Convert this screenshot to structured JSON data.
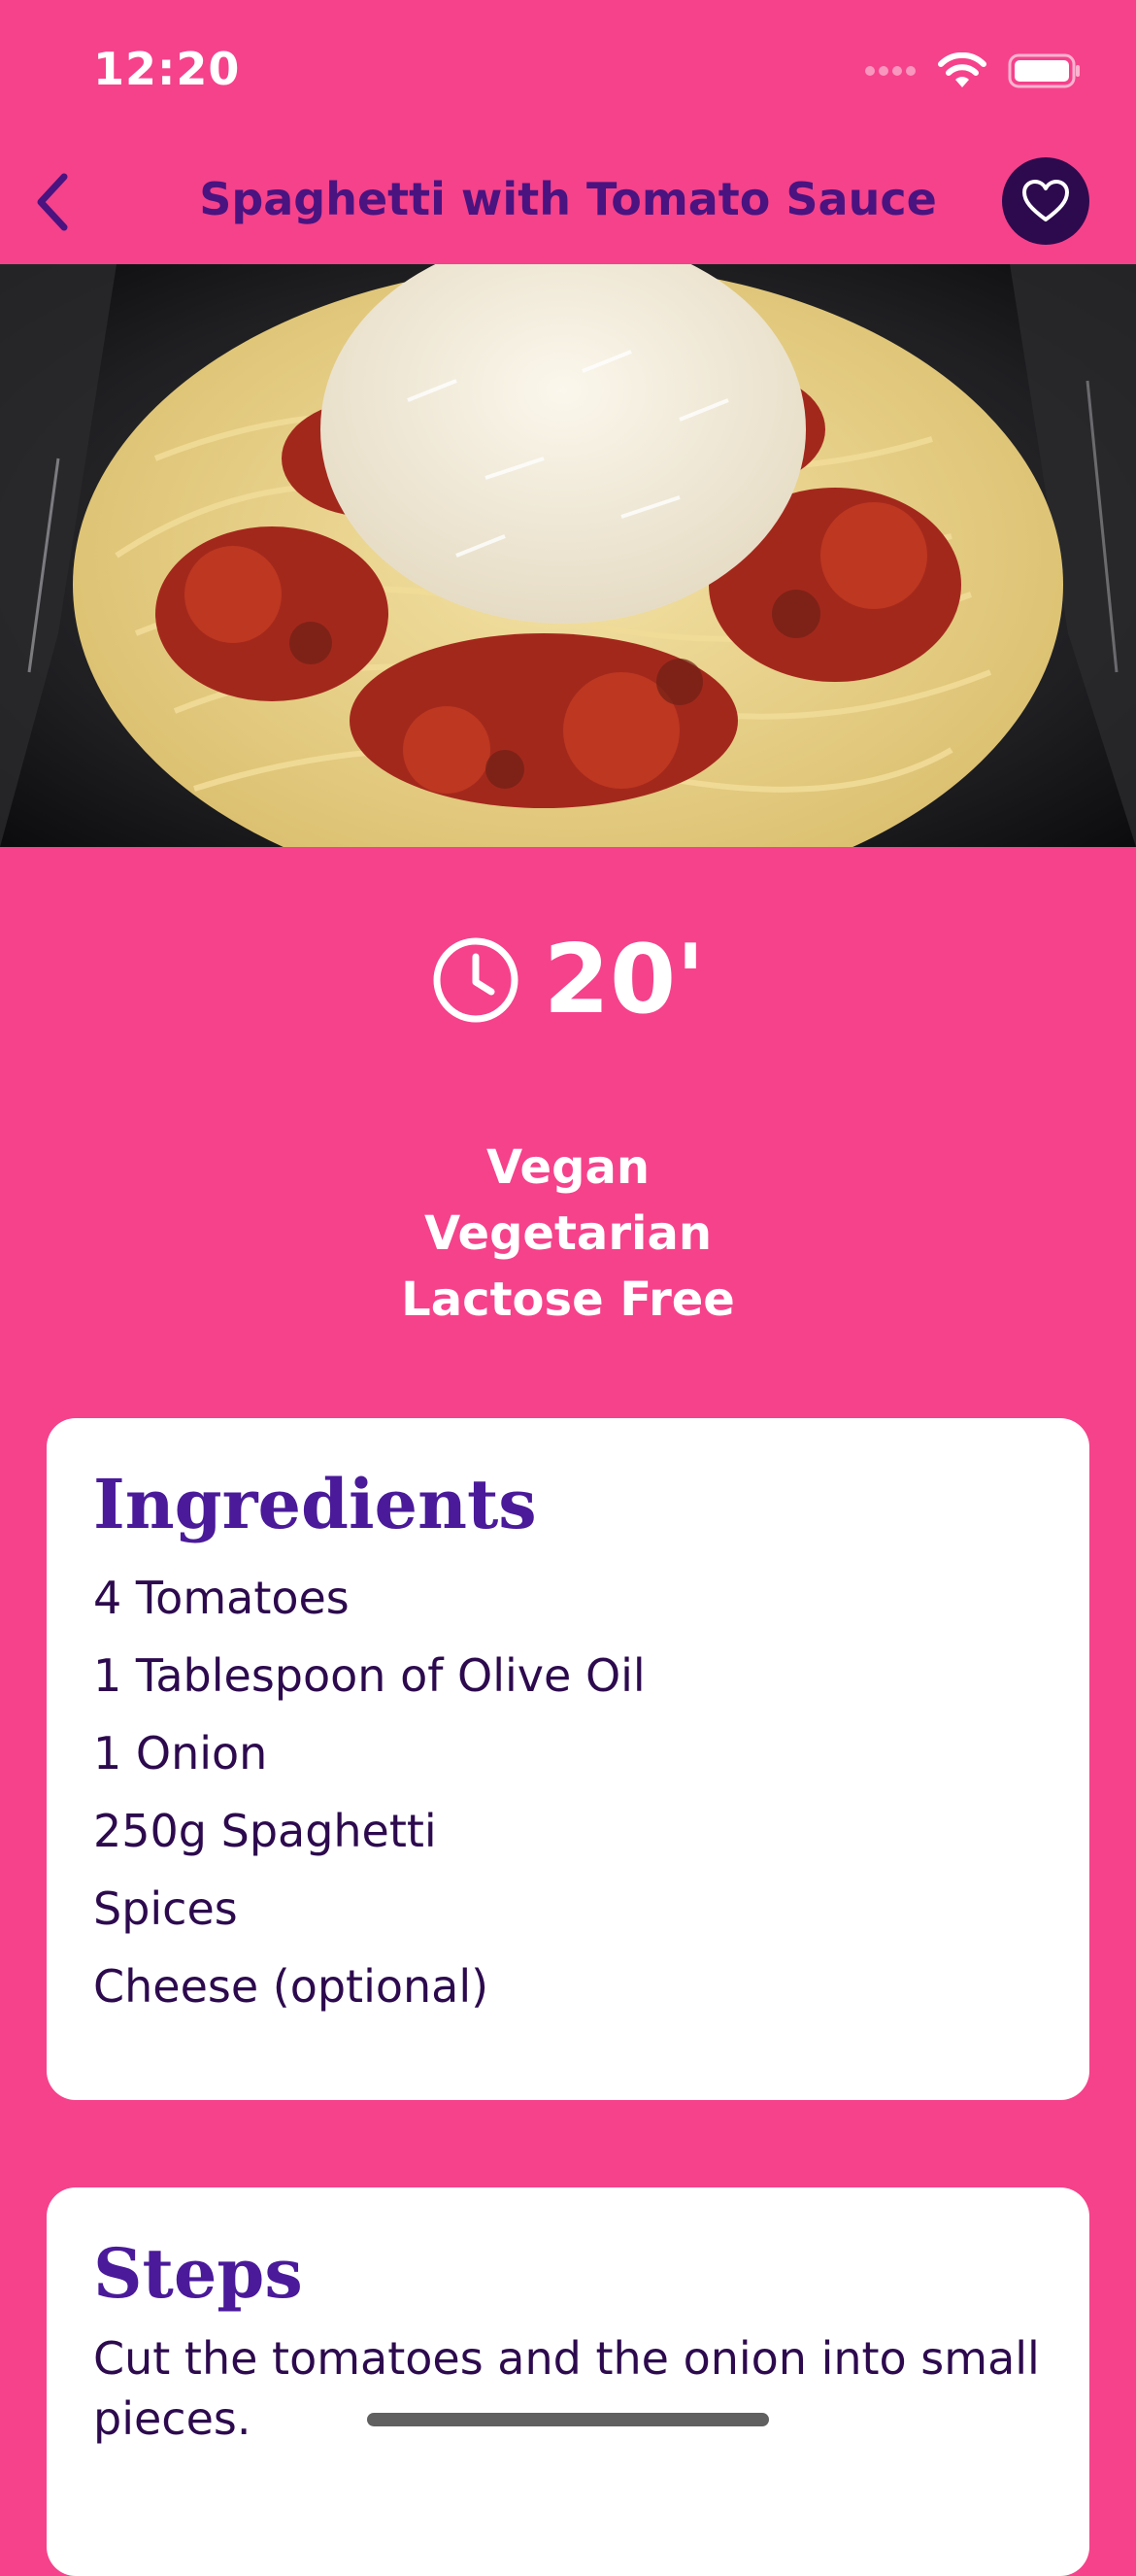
{
  "status_bar": {
    "time": "12:20"
  },
  "nav": {
    "title": "Spaghetti with Tomato Sauce"
  },
  "recipe": {
    "duration": "20'",
    "tags": [
      "Vegan",
      "Vegetarian",
      "Lactose Free"
    ]
  },
  "ingredients": {
    "title": "Ingredients",
    "items": [
      "4 Tomatoes",
      "1 Tablespoon of Olive Oil",
      "1 Onion",
      "250g Spaghetti",
      "Spices",
      "Cheese (optional)"
    ]
  },
  "steps": {
    "title": "Steps",
    "items": [
      "Cut the tomatoes and the onion into small pieces."
    ]
  },
  "icons": {
    "back": "chevron-left-icon",
    "favorite": "heart-outline-icon",
    "clock": "clock-icon",
    "signal": "cellular-signal-icon",
    "wifi": "wifi-icon",
    "battery": "battery-icon"
  },
  "colors": {
    "background": "#F5428B",
    "title": "#4A1380",
    "card_title": "#4A1A9A",
    "favorite_bg": "#2D0A4E",
    "text": "#2D0A4E"
  }
}
